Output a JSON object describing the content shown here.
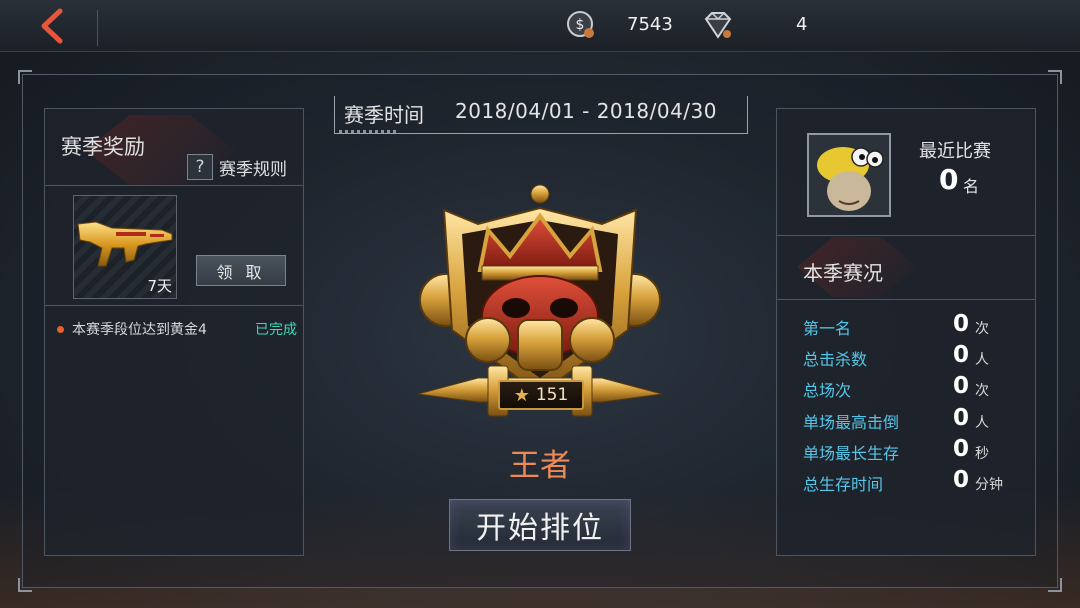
{
  "topbar": {
    "coins": "7543",
    "gems": "4"
  },
  "rewards": {
    "title": "赛季奖励",
    "rules_label": "赛季规则",
    "rules_icon": "?",
    "item_duration": "7天",
    "claim_label": "领 取",
    "task_text": "本赛季段位达到黄金4",
    "task_status": "已完成"
  },
  "season": {
    "label": "赛季时间",
    "dates": "2018/04/01 - 2018/04/30"
  },
  "rank": {
    "stars": "151",
    "name": "王者",
    "start_label": "开始排位"
  },
  "recent": {
    "title": "最近比赛",
    "value": "0",
    "unit": "名"
  },
  "stats": {
    "title": "本季赛况",
    "rows": [
      {
        "label": "第一名",
        "value": "0",
        "unit": "次"
      },
      {
        "label": "总击杀数",
        "value": "0",
        "unit": "人"
      },
      {
        "label": "总场次",
        "value": "0",
        "unit": "次"
      },
      {
        "label": "单场最高击倒",
        "value": "0",
        "unit": "人"
      },
      {
        "label": "单场最长生存",
        "value": "0",
        "unit": "秒"
      },
      {
        "label": "总生存时间",
        "value": "0",
        "unit": "分钟"
      }
    ]
  },
  "colors": {
    "accent_orange": "#f08a55",
    "stat_label_cyan": "#56c6e8",
    "task_done_green": "#3fd7b6"
  },
  "icons": [
    "back-arrow-icon",
    "coin-icon",
    "gem-icon",
    "question-icon",
    "gun-icon",
    "crown-badge-icon",
    "star-icon",
    "avatar-image"
  ]
}
